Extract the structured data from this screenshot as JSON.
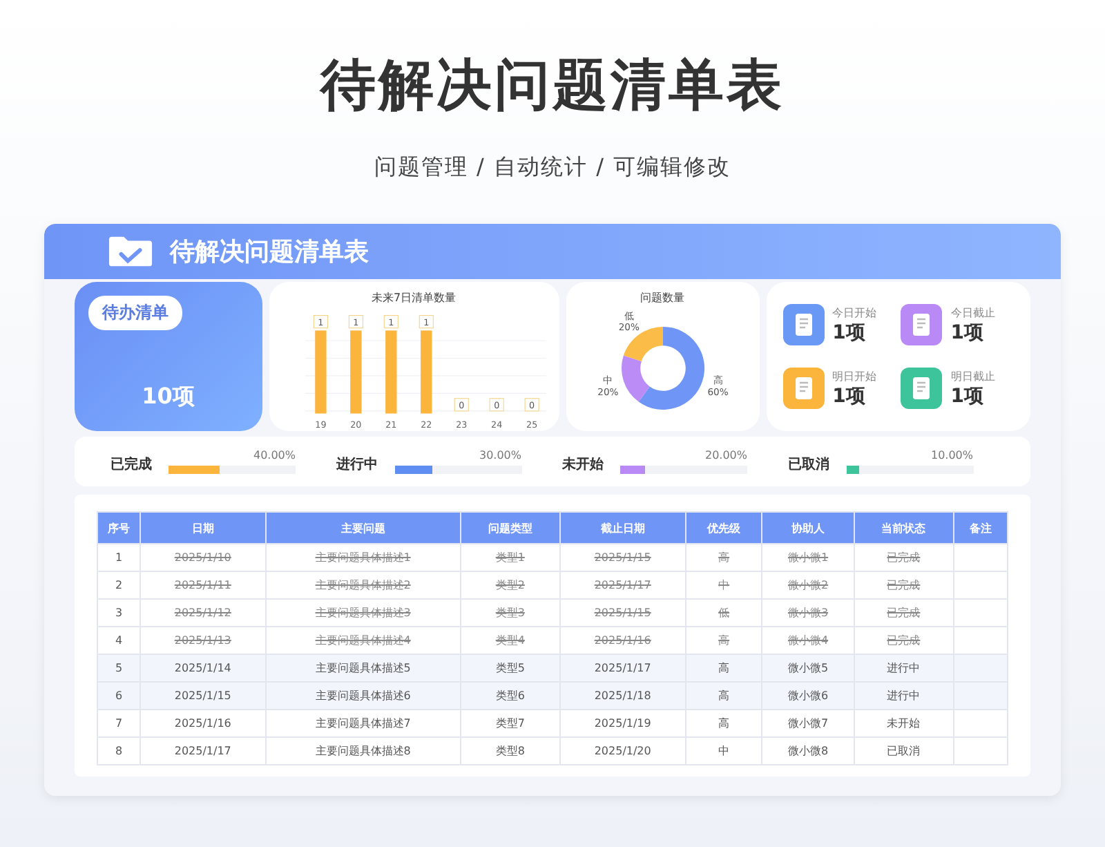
{
  "page": {
    "title": "待解决问题清单表",
    "subtitle": "问题管理 / 自动统计 / 可编辑修改"
  },
  "panel": {
    "title": "待解决问题清单表"
  },
  "todo": {
    "label": "待办清单",
    "value": "10项"
  },
  "bar_chart": {
    "chart_data": {
      "type": "bar",
      "title": "未来7日清单数量",
      "categories": [
        "19",
        "20",
        "21",
        "22",
        "23",
        "24",
        "25"
      ],
      "values": [
        1,
        1,
        1,
        1,
        0,
        0,
        0
      ],
      "data_labels": true
    }
  },
  "donut_chart": {
    "chart_data": {
      "type": "donut",
      "title": "问题数量",
      "categories": [
        "高",
        "中",
        "低"
      ],
      "values": [
        60,
        20,
        20
      ],
      "value_labels": [
        "60%",
        "20%",
        "20%"
      ],
      "colors": [
        "#6f95f7",
        "#bb8cf5",
        "#fbbd48"
      ]
    }
  },
  "stats": [
    {
      "label": "今日开始",
      "value": "1项",
      "color": "#6a98f5"
    },
    {
      "label": "今日截止",
      "value": "1项",
      "color": "#b98af5"
    },
    {
      "label": "明日开始",
      "value": "1项",
      "color": "#fbb43c"
    },
    {
      "label": "明日截止",
      "value": "1项",
      "color": "#3ec49a"
    }
  ],
  "progress": [
    {
      "label": "已完成",
      "reading": "40.00%",
      "level": 0.4,
      "color": "#fbb43c"
    },
    {
      "label": "进行中",
      "reading": "30.00%",
      "level": 0.3,
      "color": "#5f8ef2"
    },
    {
      "label": "未开始",
      "reading": "20.00%",
      "level": 0.2,
      "color": "#b98af5"
    },
    {
      "label": "已取消",
      "reading": "10.00%",
      "level": 0.1,
      "color": "#3ec49a"
    }
  ],
  "table": {
    "columns": [
      "序号",
      "日期",
      "主要问题",
      "问题类型",
      "截止日期",
      "优先级",
      "协助人",
      "当前状态",
      "备注"
    ],
    "rows": [
      {
        "cells": [
          "1",
          "2025/1/10",
          "主要问题具体描述1",
          "类型1",
          "2025/1/15",
          "高",
          "微小微1",
          "已完成",
          ""
        ],
        "done": true,
        "highlighted": false
      },
      {
        "cells": [
          "2",
          "2025/1/11",
          "主要问题具体描述2",
          "类型2",
          "2025/1/17",
          "中",
          "微小微2",
          "已完成",
          ""
        ],
        "done": true,
        "highlighted": false
      },
      {
        "cells": [
          "3",
          "2025/1/12",
          "主要问题具体描述3",
          "类型3",
          "2025/1/15",
          "低",
          "微小微3",
          "已完成",
          ""
        ],
        "done": true,
        "highlighted": false
      },
      {
        "cells": [
          "4",
          "2025/1/13",
          "主要问题具体描述4",
          "类型4",
          "2025/1/16",
          "高",
          "微小微4",
          "已完成",
          ""
        ],
        "done": true,
        "highlighted": false
      },
      {
        "cells": [
          "5",
          "2025/1/14",
          "主要问题具体描述5",
          "类型5",
          "2025/1/17",
          "高",
          "微小微5",
          "进行中",
          ""
        ],
        "done": false,
        "highlighted": true
      },
      {
        "cells": [
          "6",
          "2025/1/15",
          "主要问题具体描述6",
          "类型6",
          "2025/1/18",
          "高",
          "微小微6",
          "进行中",
          ""
        ],
        "done": false,
        "highlighted": true
      },
      {
        "cells": [
          "7",
          "2025/1/16",
          "主要问题具体描述7",
          "类型7",
          "2025/1/19",
          "高",
          "微小微7",
          "未开始",
          ""
        ],
        "done": false,
        "highlighted": false
      },
      {
        "cells": [
          "8",
          "2025/1/17",
          "主要问题具体描述8",
          "类型8",
          "2025/1/20",
          "中",
          "微小微8",
          "已取消",
          ""
        ],
        "done": false,
        "highlighted": false
      }
    ]
  }
}
